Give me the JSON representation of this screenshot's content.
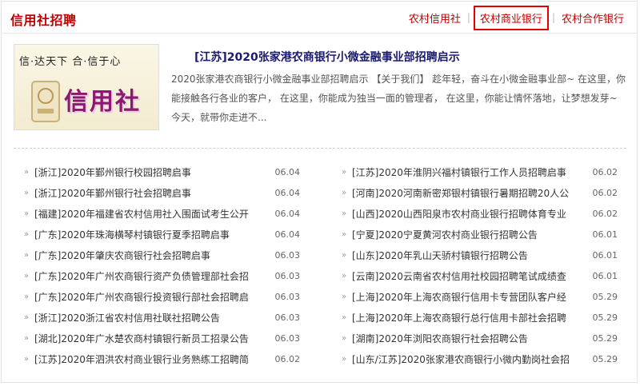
{
  "header": {
    "title": "信用社招聘",
    "tabs": [
      {
        "label": "农村信用社",
        "active": false
      },
      {
        "label": "农村商业银行",
        "active": true
      },
      {
        "label": "农村合作银行",
        "active": false
      }
    ],
    "tab_separator": "|"
  },
  "featured": {
    "logo": {
      "slogan": "信·达天下 合·信于心",
      "main_text": "信用社"
    },
    "title": "[江苏]2020张家港农商银行小微金融事业部招聘启示",
    "description": "2020张家港农商银行小微金融事业部招聘启示 【关于我们】 趁年轻，奋斗在小微金融事业部~ 在这里，你能接触各行各业的客户， 在这里，你能成为独当一面的管理者， 在这里，你能让情怀落地，让梦想发芽~ 今天，就带你走进不..."
  },
  "bullet": "»",
  "left_list": [
    {
      "text": "[浙江]2020年鄞州银行校园招聘启事",
      "date": "06.04"
    },
    {
      "text": "[浙江]2020年鄞州银行社会招聘启事",
      "date": "06.04"
    },
    {
      "text": "[福建]2020年福建省农村信用社入围面试考生公开",
      "date": "06.04"
    },
    {
      "text": "[广东]2020年珠海横琴村镇银行夏季招聘启事",
      "date": "06.04"
    },
    {
      "text": "[广东]2020年肇庆农商银行社会招聘启事",
      "date": "06.03"
    },
    {
      "text": "[广东]2020年广州农商银行资产负债管理部社会招",
      "date": "06.03"
    },
    {
      "text": "[广东]2020年广州农商银行投资银行部社会招聘启",
      "date": "06.03"
    },
    {
      "text": "[浙江]2020浙江省农村信用社联社招聘公告",
      "date": "06.03"
    },
    {
      "text": "[湖北]2020年广水楚农商村镇银行新员工招录公告",
      "date": "06.03"
    },
    {
      "text": "[江苏]2020年泗洪农村商业银行业务熟练工招聘简",
      "date": "06.02"
    }
  ],
  "right_list": [
    {
      "text": "[江苏]2020年淮阴兴福村镇银行工作人员招聘启事",
      "date": "06.02"
    },
    {
      "text": "[河南]2020河南新密郑银村镇银行暑期招聘20人公",
      "date": "06.02"
    },
    {
      "text": "[山西]2020山西阳泉市农村商业银行招聘体育专业",
      "date": "06.02"
    },
    {
      "text": "[宁夏]2020宁夏黄河农村商业银行招聘公告",
      "date": "06.01"
    },
    {
      "text": "[山东]2020年乳山天骄村镇银行招聘公告",
      "date": "06.01"
    },
    {
      "text": "[云南]2020云南省农村信用社校园招聘笔试成绩查",
      "date": "06.01"
    },
    {
      "text": "[上海]2020年上海农商银行信用卡专营团队客户经",
      "date": "05.29"
    },
    {
      "text": "[上海]2020年上海农商银行总行信用卡部社会招聘",
      "date": "05.29"
    },
    {
      "text": "[湖南]2020年浏阳农商银行社会招聘公告",
      "date": "05.29"
    },
    {
      "text": "[山东/江苏]2020张家港农商银行小微内勤岗社会招",
      "date": "05.29"
    }
  ]
}
